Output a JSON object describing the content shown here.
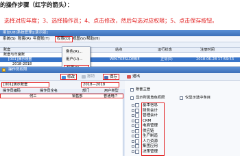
{
  "heading": "的操作步骤（红字的箭头）：",
  "instruction": "选择对应年度；3、选择操作员；4、点击修改，然后勾选对应权限；5、点击保存按钮。",
  "window": {
    "title": "用友U8[系统管理][演示版]",
    "menus": [
      "系统(S)",
      "账套(A)",
      "年度账(Y)",
      "权限(O)",
      "视图(V)",
      "帮助(H)"
    ]
  },
  "dropdown": {
    "items": [
      "角色(R)...",
      "用户(U)...",
      "权限(P)..."
    ]
  },
  "accounts": {
    "headers": [
      "账套",
      "站点",
      "运行状态",
      "注册时间"
    ],
    "tree_root": "账套与年度账",
    "selected_row": {
      "name": "[001]演示账套",
      "site": "WIN-TKESLDEBIE",
      "status": "正常(0)",
      "time": "2018-06-28 17:59:53"
    },
    "year_row": "2018-2018"
  },
  "panel": {
    "title": "操作员权限",
    "toolbar": [
      "修改",
      "撤销",
      "保存",
      "退出"
    ],
    "filter": {
      "account": "[001]演示账套",
      "year": "2018—2018",
      "checkbox": "账套主管"
    },
    "grid_headers": [
      "操作员编码",
      "操作员全名",
      "部门",
      "用户类型"
    ],
    "grid_row": {
      "name": "何三",
      "dept": "销售部",
      "type": "普通用户"
    },
    "options": [
      "显示所属角色权限",
      "仅显示选中条目"
    ],
    "tree_items": [
      "基本信息",
      "财务会计",
      "管理会计",
      "CRM",
      "电商管理",
      "供应链",
      "生产制造",
      "人力资源",
      "集团应用",
      "决策管理"
    ]
  }
}
